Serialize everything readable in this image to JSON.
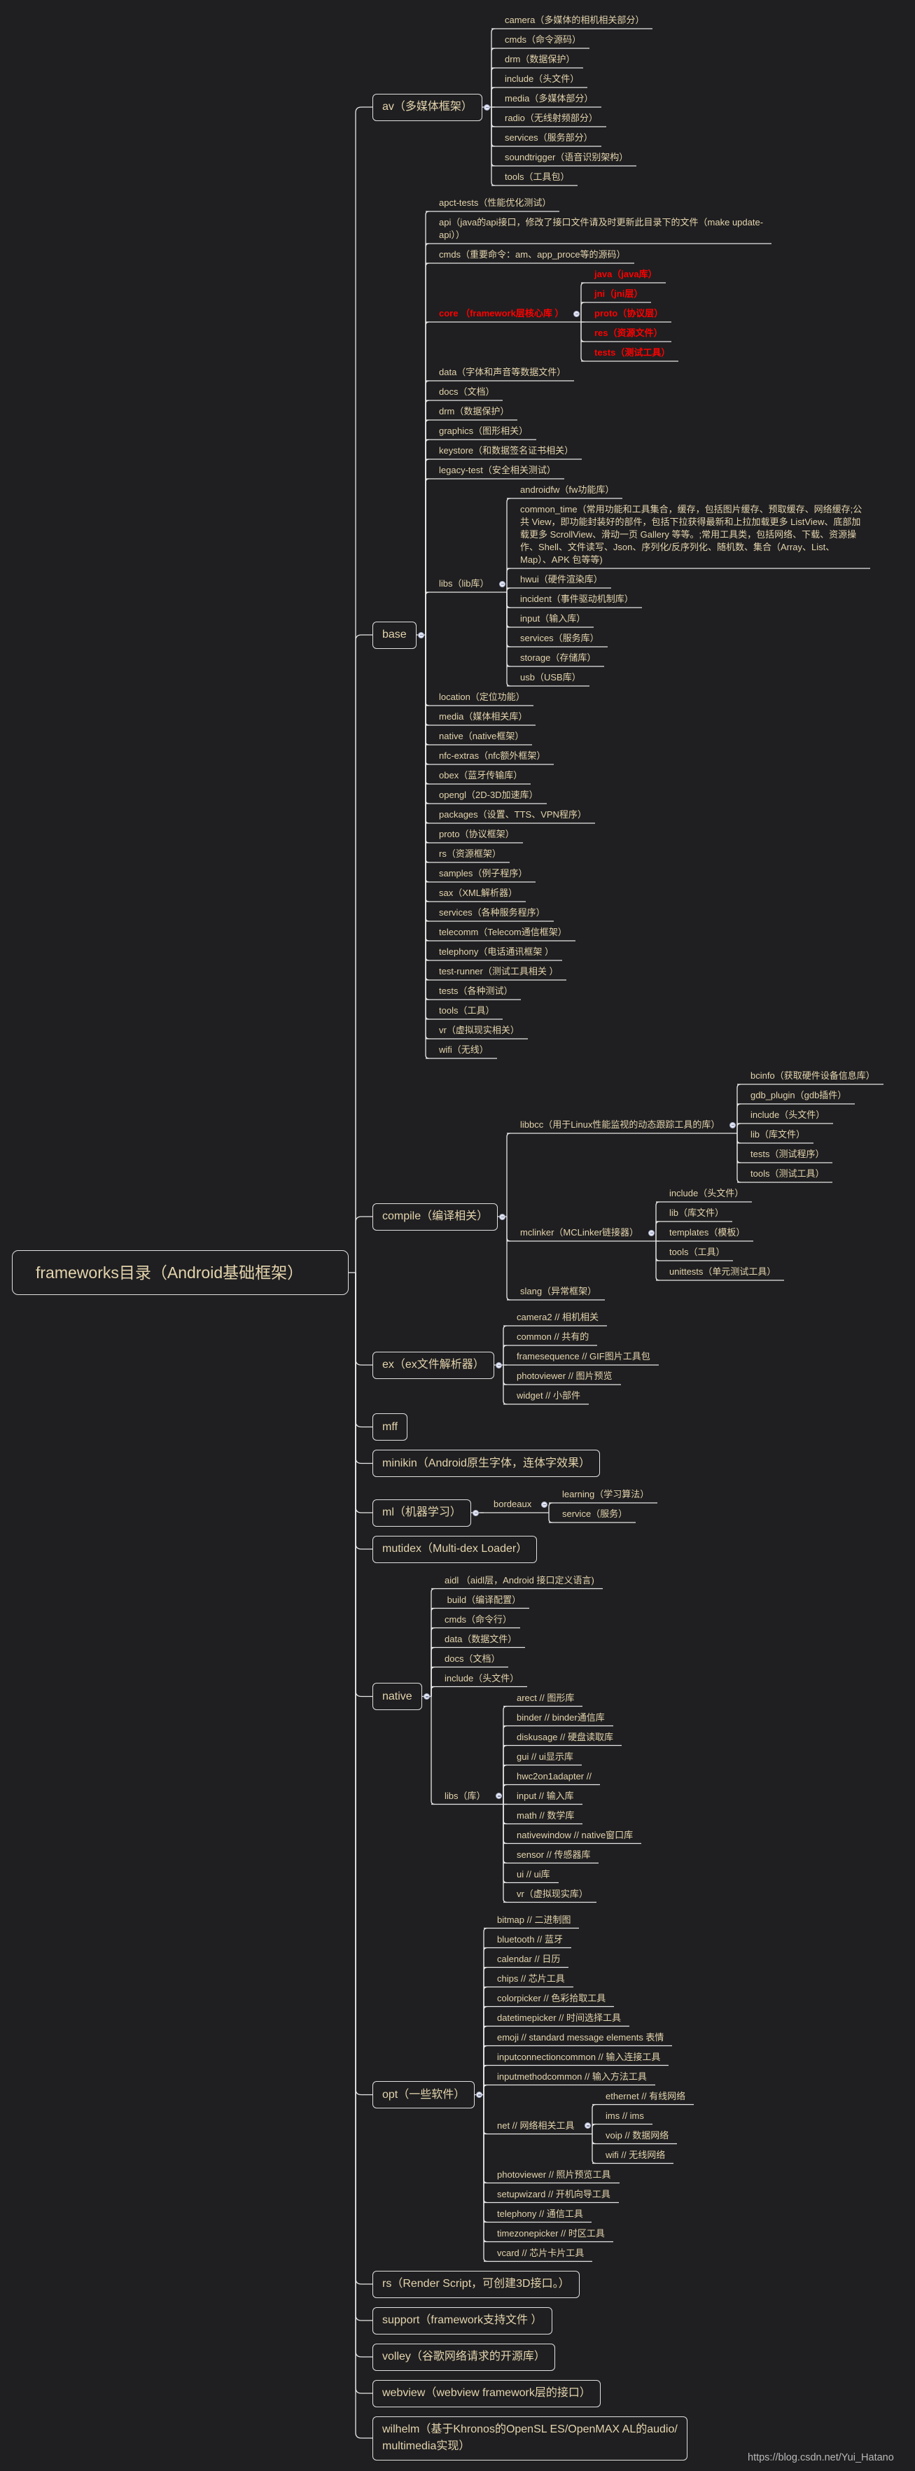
{
  "page": {
    "watermark": "https://blog.csdn.net/Yui_Hatano"
  },
  "colors": {
    "background": "#1f1f21",
    "text": "#e4d4ad",
    "highlight": "#ff0000",
    "line": "#e8e8e8",
    "border": "#e0e0e0"
  },
  "mindmap": {
    "root": "frameworks目录（Android基础框架）",
    "branches": [
      {
        "label": "av（多媒体框架）",
        "children": [
          {
            "label": "camera（多媒体的相机相关部分）"
          },
          {
            "label": "cmds（命令源码）"
          },
          {
            "label": "drm（数据保护）"
          },
          {
            "label": "include（头文件）"
          },
          {
            "label": "media（多媒体部分）"
          },
          {
            "label": "radio（无线射频部分）"
          },
          {
            "label": "services（服务部分）"
          },
          {
            "label": "soundtrigger（语音识别架构）"
          },
          {
            "label": "tools（工具包）"
          }
        ]
      },
      {
        "label": "base",
        "children": [
          {
            "label": "apct-tests（性能优化测试）"
          },
          {
            "label": "api（java的api接口，修改了接口文件请及时更新此目录下的文件（make update-\napi））"
          },
          {
            "label": "cmds（重要命令：am、app_proce等的源码）"
          },
          {
            "label": "core （framework层核心库 ）",
            "highlighted": true,
            "children": [
              {
                "label": "java（java库）"
              },
              {
                "label": "jni（jni层）"
              },
              {
                "label": "proto（协议层）"
              },
              {
                "label": "res（资源文件）"
              },
              {
                "label": "tests（测试工具）"
              }
            ]
          },
          {
            "label": "data（字体和声音等数据文件）"
          },
          {
            "label": "docs（文档）"
          },
          {
            "label": "drm（数据保护）"
          },
          {
            "label": "graphics（图形相关）"
          },
          {
            "label": "keystore（和数据签名证书相关）"
          },
          {
            "label": "legacy-test（安全相关测试）"
          },
          {
            "label": "libs（lib库）",
            "children": [
              {
                "label": "androidfw（fw功能库）"
              },
              {
                "label": "common_time（常用功能和工具集合，缓存，包括图片缓存、预取缓存、网络缓存;公\n共 View，即功能封装好的部件，包括下拉获得最新和上拉加载更多 ListView、底部加\n载更多 ScrollView、滑动一页 Gallery 等等。;常用工具类，包括网络、下载、资源操\n作、Shell、文件读写、Json、序列化/反序列化、随机数、集合（Array、List、\nMap）、APK 包等等)"
              },
              {
                "label": "hwui（硬件渲染库）"
              },
              {
                "label": "incident（事件驱动机制库）"
              },
              {
                "label": "input（输入库）"
              },
              {
                "label": "services（服务库）"
              },
              {
                "label": "storage（存储库）"
              },
              {
                "label": "usb（USB库）"
              }
            ]
          },
          {
            "label": "location（定位功能）"
          },
          {
            "label": "media（媒体相关库）"
          },
          {
            "label": "native（native框架）"
          },
          {
            "label": "nfc-extras（nfc额外框架）"
          },
          {
            "label": "obex（蓝牙传输库）"
          },
          {
            "label": "opengl（2D-3D加速库）"
          },
          {
            "label": "packages（设置、TTS、VPN程序）"
          },
          {
            "label": "proto（协议框架）"
          },
          {
            "label": "rs（资源框架）"
          },
          {
            "label": "samples（例子程序）"
          },
          {
            "label": "sax（XML解析器）"
          },
          {
            "label": "services（各种服务程序）"
          },
          {
            "label": "telecomm（Telecom通信框架）"
          },
          {
            "label": "telephony（电话通讯框架 ）"
          },
          {
            "label": "test-runner（测试工具相关 ）"
          },
          {
            "label": "tests（各种测试）"
          },
          {
            "label": "tools（工具）"
          },
          {
            "label": "vr（虚拟现实相关）"
          },
          {
            "label": "wifi（无线）"
          }
        ]
      },
      {
        "label": "compile（编译相关）",
        "children": [
          {
            "label": "libbcc（用于Linux性能监视的动态跟踪工具的库）",
            "children": [
              {
                "label": "bcinfo（获取硬件设备信息库）"
              },
              {
                "label": "gdb_plugin（gdb插件）"
              },
              {
                "label": "include（头文件）"
              },
              {
                "label": "lib（库文件）"
              },
              {
                "label": "tests（测试程序）"
              },
              {
                "label": "tools（测试工具）"
              }
            ]
          },
          {
            "label": "mclinker（MCLinker链接器）",
            "children": [
              {
                "label": "include（头文件）"
              },
              {
                "label": "lib（库文件）"
              },
              {
                "label": "templates（模板）"
              },
              {
                "label": "tools（工具）"
              },
              {
                "label": "unittests（单元测试工具）"
              }
            ]
          },
          {
            "label": "slang（异常框架）"
          }
        ]
      },
      {
        "label": "ex（ex文件解析器）",
        "children": [
          {
            "label": "camera2 // 相机相关"
          },
          {
            "label": "common // 共有的"
          },
          {
            "label": "framesequence // GIF图片工具包"
          },
          {
            "label": "photoviewer // 图片预览"
          },
          {
            "label": "widget // 小部件"
          }
        ]
      },
      {
        "label": "mff"
      },
      {
        "label": "minikin（Android原生字体，连体字效果）"
      },
      {
        "label": "ml（机器学习）",
        "children": [
          {
            "label": "bordeaux",
            "children": [
              {
                "label": "learning（学习算法）"
              },
              {
                "label": "service（服务）"
              }
            ]
          }
        ]
      },
      {
        "label": "mutidex（Multi-dex Loader）"
      },
      {
        "label": "native",
        "children": [
          {
            "label": "aidl （aidl层，Android 接口定义语言)"
          },
          {
            "label": " build（编译配置）"
          },
          {
            "label": "cmds（命令行）"
          },
          {
            "label": "data（数据文件）"
          },
          {
            "label": "docs（文档）"
          },
          {
            "label": "include（头文件）"
          },
          {
            "label": "libs（库）",
            "children": [
              {
                "label": "arect // 图形库"
              },
              {
                "label": "binder // binder通信库"
              },
              {
                "label": "diskusage // 硬盘读取库"
              },
              {
                "label": "gui // ui显示库"
              },
              {
                "label": "hwc2on1adapter //"
              },
              {
                "label": "input // 输入库"
              },
              {
                "label": "math // 数学库"
              },
              {
                "label": "nativewindow // native窗口库"
              },
              {
                "label": "sensor // 传感器库"
              },
              {
                "label": "ui // ui库"
              },
              {
                "label": "vr（虚拟现实库）"
              }
            ]
          }
        ]
      },
      {
        "label": "opt（一些软件）",
        "children": [
          {
            "label": "bitmap // 二进制图"
          },
          {
            "label": "bluetooth // 蓝牙"
          },
          {
            "label": "calendar // 日历"
          },
          {
            "label": "chips // 芯片工具"
          },
          {
            "label": "colorpicker // 色彩拾取工具"
          },
          {
            "label": "datetimepicker // 时间选择工具"
          },
          {
            "label": "emoji // standard message elements 表情"
          },
          {
            "label": "inputconnectioncommon // 输入连接工具"
          },
          {
            "label": "inputmethodcommon // 输入方法工具"
          },
          {
            "label": "net // 网络相关工具",
            "children": [
              {
                "label": "ethernet // 有线网络"
              },
              {
                "label": "ims // ims"
              },
              {
                "label": "voip // 数据网络"
              },
              {
                "label": "wifi // 无线网络"
              }
            ]
          },
          {
            "label": "photoviewer // 照片预览工具"
          },
          {
            "label": "setupwizard // 开机向导工具"
          },
          {
            "label": "telephony // 通信工具"
          },
          {
            "label": "timezonepicker // 时区工具"
          },
          {
            "label": "vcard // 芯片卡片工具"
          }
        ]
      },
      {
        "label": "rs（Render Script，可创建3D接口。）"
      },
      {
        "label": "support（framework支持文件 ）"
      },
      {
        "label": "volley（谷歌网络请求的开源库）"
      },
      {
        "label": "webview（webview framework层的接口）"
      },
      {
        "label": "wilhelm（基于Khronos的OpenSL ES/OpenMAX AL的audio/\nmultimedia实现）"
      }
    ]
  }
}
